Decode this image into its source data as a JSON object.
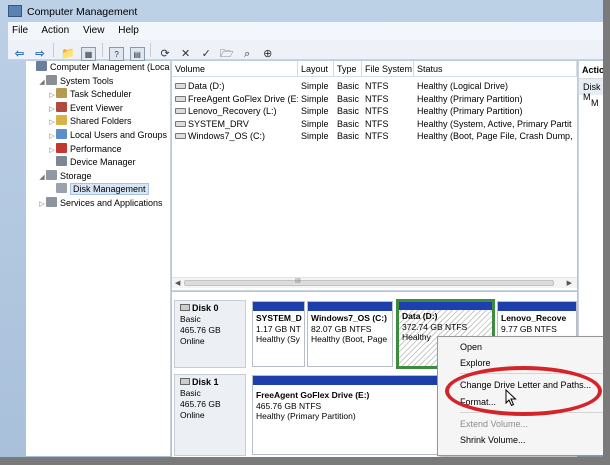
{
  "window": {
    "title": "Computer Management"
  },
  "menu": [
    "File",
    "Action",
    "View",
    "Help"
  ],
  "toolbar": {
    "icons": [
      "back-arrow",
      "forward-arrow",
      "up-folder",
      "show-hide-tree",
      "help",
      "properties",
      "refresh",
      "delete",
      "check",
      "open",
      "find",
      "zoom"
    ]
  },
  "tree": {
    "items": [
      {
        "label": "Computer Management (Local",
        "level": 0,
        "arrow": "",
        "icon": "computer-icon",
        "color": "#6b7f98"
      },
      {
        "label": "System Tools",
        "level": 1,
        "arrow": "◢",
        "icon": "tools-icon",
        "color": "#8a8f97"
      },
      {
        "label": "Task Scheduler",
        "level": 2,
        "arrow": "▷",
        "icon": "clock-icon",
        "color": "#b59b52"
      },
      {
        "label": "Event Viewer",
        "level": 2,
        "arrow": "▷",
        "icon": "event-icon",
        "color": "#b04a3c"
      },
      {
        "label": "Shared Folders",
        "level": 2,
        "arrow": "▷",
        "icon": "shared-folder-icon",
        "color": "#d6b24a"
      },
      {
        "label": "Local Users and Groups",
        "level": 2,
        "arrow": "▷",
        "icon": "users-icon",
        "color": "#5c8ec9"
      },
      {
        "label": "Performance",
        "level": 2,
        "arrow": "▷",
        "icon": "performance-icon",
        "color": "#c2382f"
      },
      {
        "label": "Device Manager",
        "level": 2,
        "arrow": "",
        "icon": "device-manager-icon",
        "color": "#7c8795"
      },
      {
        "label": "Storage",
        "level": 1,
        "arrow": "◢",
        "icon": "storage-icon",
        "color": "#8f98a3"
      },
      {
        "label": "Disk Management",
        "level": 2,
        "arrow": "",
        "icon": "disk-icon",
        "color": "#9aa3ad",
        "selected": true
      },
      {
        "label": "Services and Applications",
        "level": 1,
        "arrow": "▷",
        "icon": "services-icon",
        "color": "#8c949e"
      }
    ]
  },
  "volumes": {
    "headers": [
      "Volume",
      "Layout",
      "Type",
      "File System",
      "Status"
    ],
    "rows": [
      [
        "Data (D:)",
        "Simple",
        "Basic",
        "NTFS",
        "Healthy (Logical Drive)"
      ],
      [
        "FreeAgent GoFlex Drive (E:)",
        "Simple",
        "Basic",
        "NTFS",
        "Healthy (Primary Partition)"
      ],
      [
        "Lenovo_Recovery (L:)",
        "Simple",
        "Basic",
        "NTFS",
        "Healthy (Primary Partition)"
      ],
      [
        "SYSTEM_DRV",
        "Simple",
        "Basic",
        "NTFS",
        "Healthy (System, Active, Primary Partit"
      ],
      [
        "Windows7_OS (C:)",
        "Simple",
        "Basic",
        "NTFS",
        "Healthy (Boot, Page File, Crash Dump,"
      ]
    ],
    "scroll_grip": "III"
  },
  "disks": [
    {
      "name": "Disk 0",
      "type": "Basic",
      "size": "465.76 GB",
      "status": "Online",
      "partitions": [
        {
          "title": "SYSTEM_D",
          "size": "1.17 GB NT",
          "status": "Healthy (Sy"
        },
        {
          "title": "Windows7_OS  (C:)",
          "size": "82.07 GB NTFS",
          "status": "Healthy (Boot, Page"
        },
        {
          "title": "Data  (D:)",
          "size": "372.74 GB NTFS",
          "status": "Healthy",
          "selected": true
        },
        {
          "title": "Lenovo_Recove",
          "size": "9.77 GB NTFS",
          "status": ""
        }
      ]
    },
    {
      "name": "Disk 1",
      "type": "Basic",
      "size": "465.76 GB",
      "status": "Online",
      "partitions": [
        {
          "title": "FreeAgent GoFlex Drive  (E:)",
          "size": "465.76 GB NTFS",
          "status": "Healthy (Primary Partition)"
        }
      ]
    }
  ],
  "actions": {
    "header": "Action",
    "item1": "Disk M",
    "item2": "M"
  },
  "context_menu": {
    "items": [
      {
        "label": "Open",
        "disabled": false
      },
      {
        "label": "Explore",
        "disabled": false
      },
      {
        "label": "Change Drive Letter and Paths...",
        "disabled": false
      },
      {
        "label": "Format...",
        "disabled": false
      },
      {
        "label": "Extend Volume...",
        "disabled": true
      },
      {
        "label": "Shrink Volume...",
        "disabled": false
      }
    ]
  },
  "colors": {
    "highlight_oval": "#d5232a",
    "partition_bar": "#1c3fa9",
    "selection_border": "#3d8b3d"
  }
}
